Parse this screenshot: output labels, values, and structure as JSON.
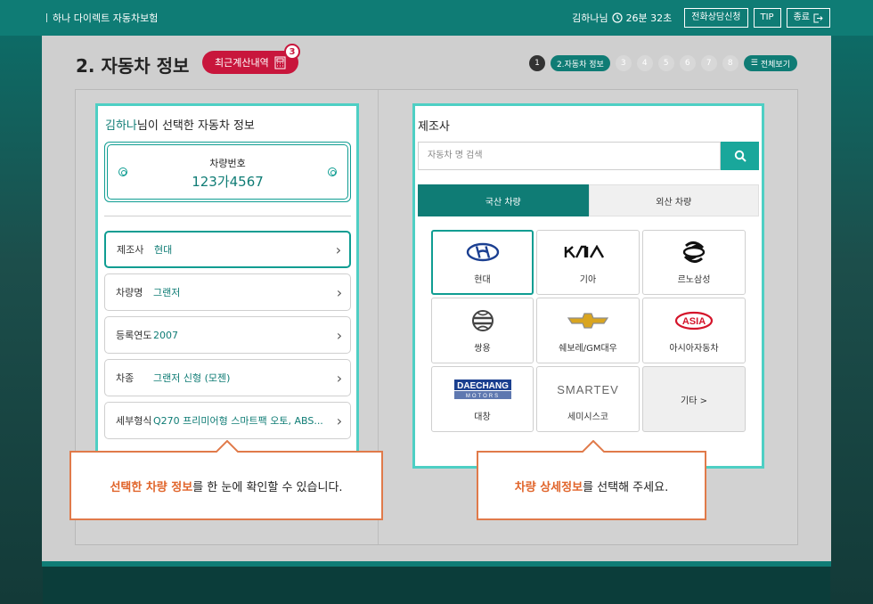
{
  "topbar": {
    "brand": "하나 다이렉트 자동차보험",
    "user": "김하나님",
    "timer": "26분 32초",
    "consult": "전화상담신청",
    "tip": "TIP",
    "exit": "종료"
  },
  "page": {
    "title": "2. 자동차 정보",
    "recent_label": "최근계산내역",
    "recent_count": "3"
  },
  "steps": {
    "items": [
      "1",
      "2.자동차 정보",
      "3",
      "4",
      "5",
      "6",
      "7",
      "8"
    ],
    "all_label": "전체보기"
  },
  "left": {
    "heading_name": "김하나",
    "heading_rest": "님이 선택한 자동차 정보",
    "plate_label": "차량번호",
    "plate_number": "123가4567",
    "rows": [
      {
        "key": "제조사",
        "value": "현대"
      },
      {
        "key": "차량명",
        "value": "그랜저"
      },
      {
        "key": "등록연도",
        "value": "2007"
      },
      {
        "key": "차종",
        "value": "그랜저 신형 (모젠)"
      },
      {
        "key": "세부형식",
        "value": "Q270 프리미어형 스마트팩 오토, ABS..."
      }
    ]
  },
  "right": {
    "heading": "제조사",
    "search_placeholder": "자동차 명 검색",
    "tabs": [
      "국산 차량",
      "외산 차량"
    ],
    "makers": [
      "현대",
      "기아",
      "르노삼성",
      "쌍용",
      "쉐보레/GM대우",
      "아시아자동차",
      "대창",
      "세미시스코"
    ],
    "etc_label": "기타 >",
    "logo_texts": {
      "asia": "ASIA",
      "daechang_top": "DAECHANG",
      "daechang_bottom": "MOTORS",
      "smartev": "SMARTEV"
    }
  },
  "callouts": {
    "left_hl": "선택한 차량 정보",
    "left_rest": "를 한 눈에 확인할 수 있습니다.",
    "right_hl": "차량 상세정보",
    "right_rest": "를 선택해 주세요."
  },
  "colors": {
    "primary": "#0f7c75",
    "accent": "#4ecfc4",
    "red": "#c8163c",
    "orange": "#e07a4a"
  }
}
